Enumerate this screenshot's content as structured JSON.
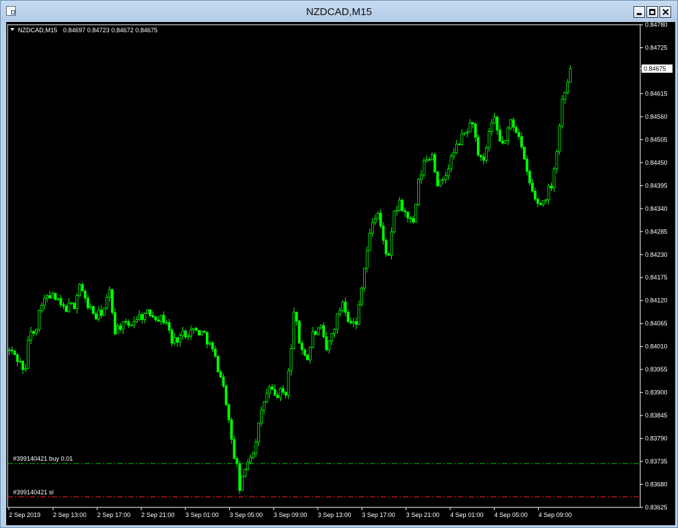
{
  "window": {
    "title": "NZDCAD,M15"
  },
  "chart_header": {
    "symbol": "NZDCAD,M15",
    "ohlc": "0.84697 0.84723 0.84672 0.84675"
  },
  "orders": [
    {
      "label": "#399140421 buy 0.01",
      "price": 0.8373,
      "color": "#00c800"
    },
    {
      "label": "#399140421 sl",
      "price": 0.8365,
      "color": "#ff2020"
    }
  ],
  "current_price": {
    "label": "0.84675",
    "value": 0.84675
  },
  "colors": {
    "background": "#000000",
    "candle": "#00ff00",
    "axis_text": "#ffffff",
    "frame": "#ffffff"
  },
  "chart_data": {
    "type": "candlestick",
    "symbol": "NZDCAD",
    "timeframe": "M15",
    "ylim": [
      0.83625,
      0.8478
    ],
    "y_ticks": [
      "0.84780",
      "0.84725",
      "0.84675",
      "0.84615",
      "0.84560",
      "0.84505",
      "0.84450",
      "0.84395",
      "0.84340",
      "0.84285",
      "0.84230",
      "0.84175",
      "0.84120",
      "0.84065",
      "0.84010",
      "0.83955",
      "0.83900",
      "0.83845",
      "0.83790",
      "0.83735",
      "0.83680",
      "0.83625"
    ],
    "x_ticks": [
      "2 Sep 2019",
      "2 Sep 13:00",
      "2 Sep 17:00",
      "2 Sep 21:00",
      "3 Sep 01:00",
      "3 Sep 05:00",
      "3 Sep 09:00",
      "3 Sep 13:00",
      "3 Sep 17:00",
      "3 Sep 21:00",
      "4 Sep 01:00",
      "4 Sep 05:00",
      "4 Sep 09:00"
    ],
    "close_path": [
      [
        0,
        0.84
      ],
      [
        2,
        0.8399
      ],
      [
        6,
        0.8395
      ],
      [
        7,
        0.8403
      ],
      [
        10,
        0.8406
      ],
      [
        12,
        0.8412
      ],
      [
        16,
        0.8413
      ],
      [
        20,
        0.841
      ],
      [
        24,
        0.8411
      ],
      [
        26,
        0.8416
      ],
      [
        28,
        0.8412
      ],
      [
        32,
        0.8408
      ],
      [
        35,
        0.841
      ],
      [
        37,
        0.8414
      ],
      [
        39,
        0.8405
      ],
      [
        41,
        0.8406
      ],
      [
        44,
        0.8406
      ],
      [
        47,
        0.8408
      ],
      [
        52,
        0.8409
      ],
      [
        55,
        0.8408
      ],
      [
        58,
        0.8407
      ],
      [
        60,
        0.8402
      ],
      [
        64,
        0.8404
      ],
      [
        68,
        0.8405
      ],
      [
        72,
        0.8404
      ],
      [
        75,
        0.84
      ],
      [
        78,
        0.8394
      ],
      [
        80,
        0.8388
      ],
      [
        82,
        0.8378
      ],
      [
        84,
        0.8372
      ],
      [
        85,
        0.8367
      ],
      [
        86,
        0.8369
      ],
      [
        88,
        0.8374
      ],
      [
        90,
        0.8376
      ],
      [
        92,
        0.8382
      ],
      [
        94,
        0.8388
      ],
      [
        96,
        0.8391
      ],
      [
        98,
        0.8389
      ],
      [
        100,
        0.839
      ],
      [
        102,
        0.839
      ],
      [
        104,
        0.84
      ],
      [
        105,
        0.841
      ],
      [
        107,
        0.8402
      ],
      [
        110,
        0.8398
      ],
      [
        112,
        0.8404
      ],
      [
        115,
        0.8405
      ],
      [
        117,
        0.84
      ],
      [
        119,
        0.8404
      ],
      [
        121,
        0.8408
      ],
      [
        123,
        0.8412
      ],
      [
        125,
        0.8408
      ],
      [
        128,
        0.8406
      ],
      [
        130,
        0.8416
      ],
      [
        132,
        0.8424
      ],
      [
        134,
        0.8431
      ],
      [
        136,
        0.8433
      ],
      [
        138,
        0.8426
      ],
      [
        140,
        0.8422
      ],
      [
        142,
        0.8433
      ],
      [
        144,
        0.8435
      ],
      [
        147,
        0.8432
      ],
      [
        149,
        0.843
      ],
      [
        151,
        0.844
      ],
      [
        153,
        0.8445
      ],
      [
        156,
        0.8447
      ],
      [
        158,
        0.844
      ],
      [
        160,
        0.844
      ],
      [
        163,
        0.8446
      ],
      [
        166,
        0.845
      ],
      [
        169,
        0.8453
      ],
      [
        171,
        0.8455
      ],
      [
        173,
        0.8446
      ],
      [
        175,
        0.8445
      ],
      [
        177,
        0.8452
      ],
      [
        179,
        0.8455
      ],
      [
        181,
        0.845
      ],
      [
        183,
        0.845
      ],
      [
        185,
        0.8455
      ],
      [
        188,
        0.8452
      ],
      [
        190,
        0.8445
      ],
      [
        192,
        0.844
      ],
      [
        194,
        0.8436
      ],
      [
        196,
        0.8435
      ],
      [
        198,
        0.8437
      ],
      [
        200,
        0.844
      ],
      [
        202,
        0.8448
      ],
      [
        204,
        0.846
      ],
      [
        206,
        0.8465
      ],
      [
        207,
        0.8468
      ]
    ],
    "bars": 208,
    "last_close": 0.84675,
    "grid": false
  }
}
